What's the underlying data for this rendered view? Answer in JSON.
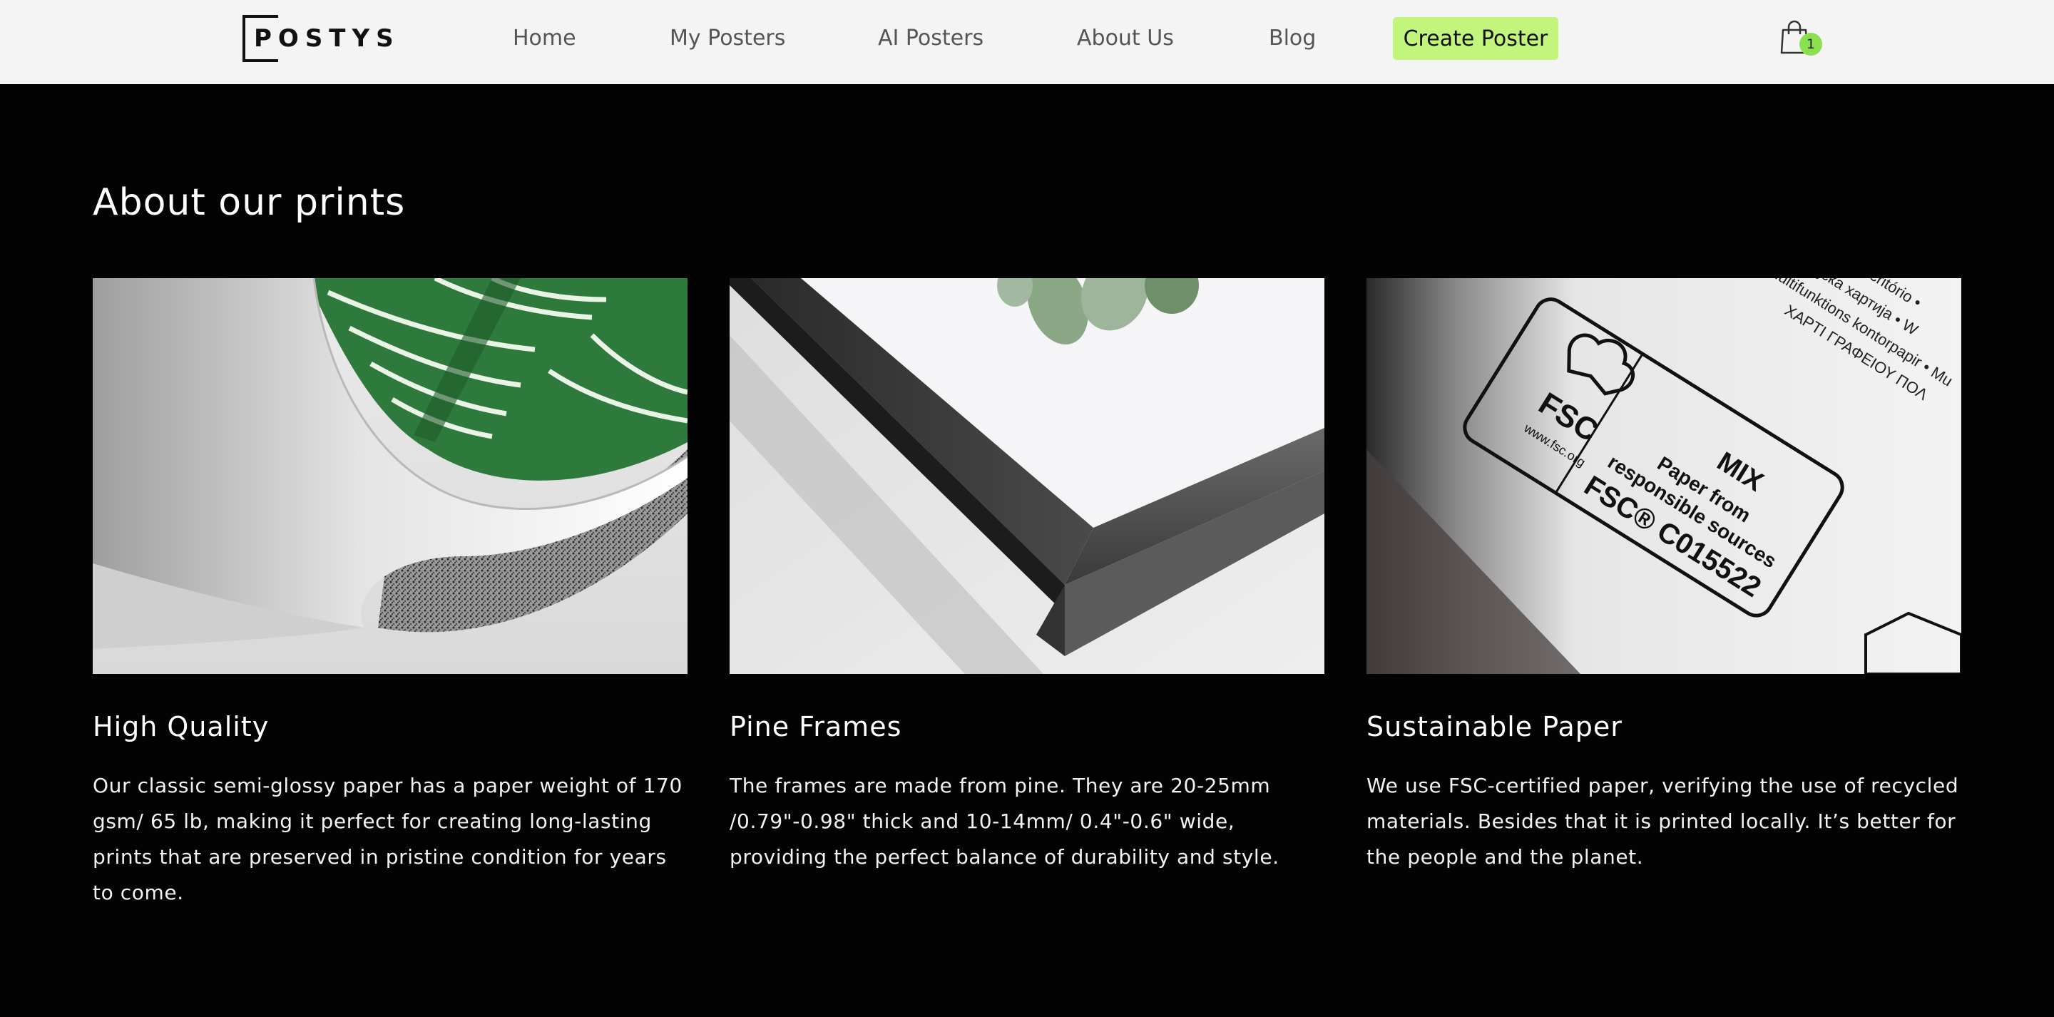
{
  "header": {
    "logo_text": "POSTYS",
    "nav": [
      {
        "label": "Home"
      },
      {
        "label": "My Posters"
      },
      {
        "label": "AI Posters"
      },
      {
        "label": "About Us"
      },
      {
        "label": "Blog"
      }
    ],
    "cta_label": "Create Poster",
    "cart_icon": "shopping-bag-icon",
    "cart_count": "1"
  },
  "main": {
    "title": "About our prints",
    "cards": [
      {
        "title": "High Quality",
        "text": "Our classic semi-glossy paper has a paper weight of 170 gsm/ 65 lb, making it perfect for creating long-lasting prints that are preserved in pristine condition for years to come."
      },
      {
        "title": "Pine Frames",
        "text": "The frames are made from pine. They are 20-25mm /0.79\"-0.98\" thick and 10-14mm/ 0.4\"-0.6\" wide, providing the perfect balance of durability and style."
      },
      {
        "title": "Sustainable Paper",
        "text": "We use FSC-certified paper, verifying the use of recycled materials. Besides that it is printed locally. It’s better for the people and the planet.",
        "image_text": {
          "fsc": "FSC",
          "url": "www.fsc.org",
          "mix": "MIX",
          "line1": "Paper from",
          "line2": "responsible sources",
          "code": "FSC® C015522",
          "multi1": "ale • Papel de escritório •",
          "multi2": "ер • канцеларијска хартија • W",
          "multi3": "ontorspapper • multifunktions kontorpapir • Mu",
          "multi4": "ΧΑΡΤΙ ΓΡΑΦΕΙΟΥ ΠΟΛ"
        }
      }
    ]
  },
  "colors": {
    "header_bg": "#f4f4f4",
    "page_bg": "#030303",
    "accent": "#c3f57c",
    "badge": "#8be04e"
  }
}
